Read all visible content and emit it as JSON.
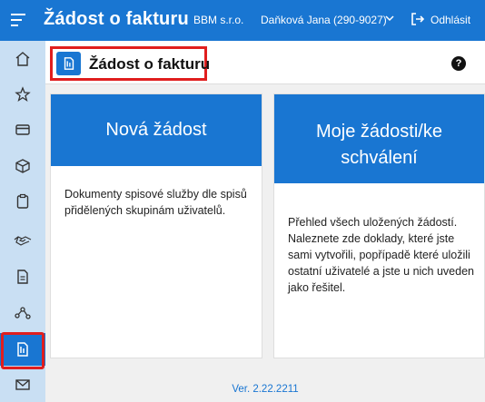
{
  "header": {
    "app_title": "Žádost o fakturu",
    "organization": "BBM s.r.o.",
    "user": "Daňková Jana (290-9027)",
    "logout_label": "Odhlásit"
  },
  "sidebar": {
    "items": [
      {
        "icon": "home-icon"
      },
      {
        "icon": "star-icon"
      },
      {
        "icon": "credit-card-icon"
      },
      {
        "icon": "package-icon"
      },
      {
        "icon": "clipboard-icon"
      },
      {
        "icon": "handshake-icon"
      },
      {
        "icon": "document-icon"
      },
      {
        "icon": "workflow-icon"
      },
      {
        "icon": "invoice-request-icon",
        "active": true
      },
      {
        "icon": "mail-icon"
      }
    ]
  },
  "page": {
    "title": "Žádost o fakturu",
    "help_glyph": "?"
  },
  "cards": [
    {
      "title": "Nová žádost",
      "description": "Dokumenty spisové služby dle spisů přidělených skupinám uživatelů."
    },
    {
      "title_line1": "Moje žádosti/ke",
      "title_line2": "schválení",
      "description": "Přehled všech uložených žádostí. Naleznete zde doklady, které jste sami vytvořili, popřípadě které uložili ostatní uživatelé a jste u nich uveden jako řešitel."
    }
  ],
  "footer": {
    "version": "Ver. 2.22.2211"
  },
  "colors": {
    "primary": "#1976d2",
    "sidebar": "#c9dff3",
    "highlight": "#e01e1e"
  }
}
